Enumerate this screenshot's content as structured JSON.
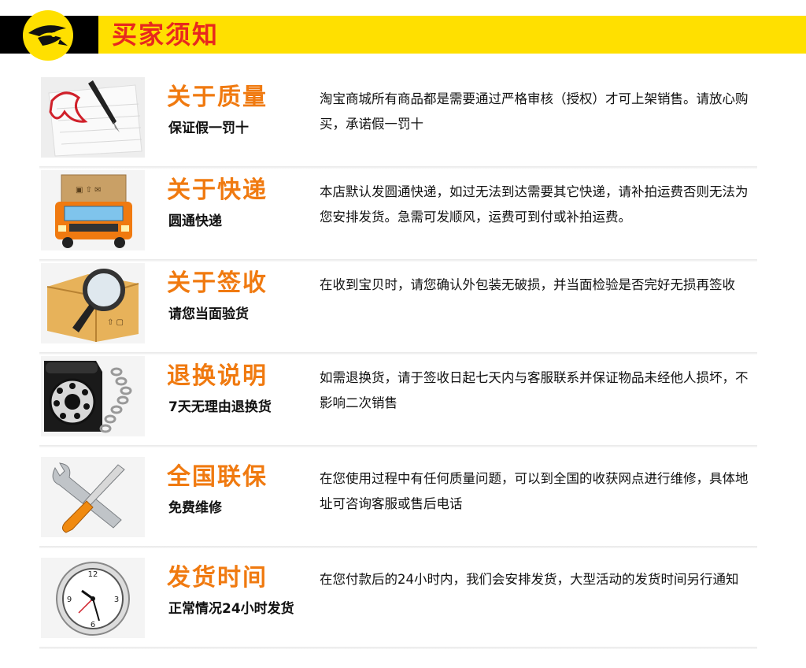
{
  "header": {
    "title": "买家须知"
  },
  "items": [
    {
      "title": "关于质量",
      "subtitle": "保证假一罚十",
      "desc": "淘宝商城所有商品都是需要通过严格审核（授权）才可上架销售。请放心购买，承诺假一罚十",
      "icon": "pen-paper-icon"
    },
    {
      "title": "关于快递",
      "subtitle": "圆通快递",
      "desc": "本店默认发圆通快递，如过无法到达需要其它快递，请补拍运费否则无法为您安排发货。急需可发顺风，运费可到付或补拍运费。",
      "icon": "delivery-truck-icon"
    },
    {
      "title": "关于签收",
      "subtitle": "请您当面验货",
      "desc": "在收到宝贝时，请您确认外包装无破损，并当面检验是否完好无损再签收",
      "icon": "magnifier-box-icon"
    },
    {
      "title": "退换说明",
      "subtitle": "7天无理由退换货",
      "desc": "如需退换货，请于签收日起七天内与客服联系并保证物品未经他人损坏，不影响二次销售",
      "icon": "telephone-icon"
    },
    {
      "title": "全国联保",
      "subtitle": "免费维修",
      "desc": "在您使用过程中有任何质量问题，可以到全国的收获网点进行维修，具体地址可咨询客服或售后电话",
      "icon": "tools-icon"
    },
    {
      "title": "发货时间",
      "subtitle": "正常情况24小时发货",
      "desc": "在您付款后的24小时内，我们会安排发货，大型活动的发货时间另行通知",
      "icon": "clock-icon"
    }
  ],
  "colors": {
    "accent": "#f07a10",
    "title_red": "#e8281e",
    "banner_yellow": "#ffe000"
  }
}
